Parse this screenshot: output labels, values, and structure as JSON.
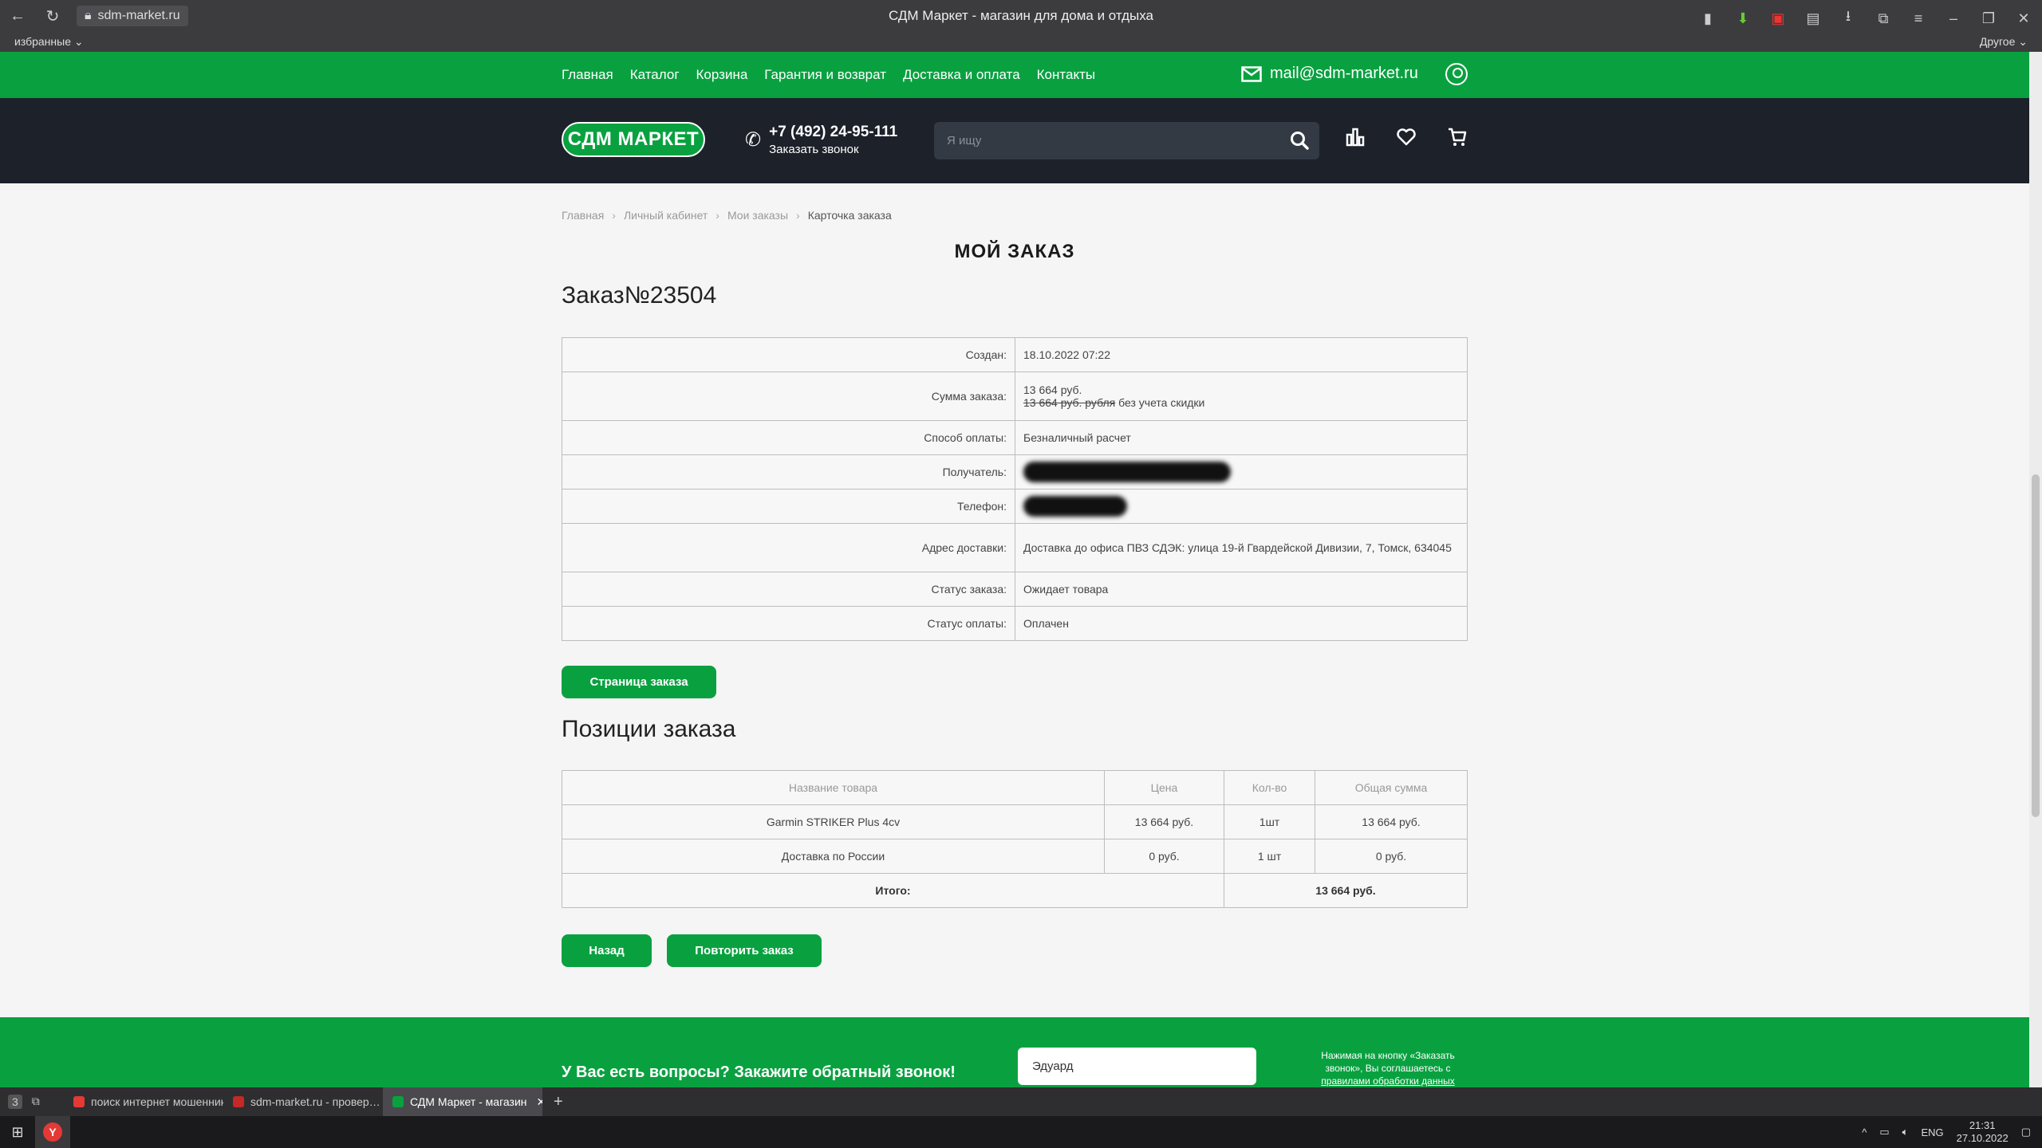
{
  "browser": {
    "url": "sdm-market.ru",
    "window_title": "СДМ Маркет - магазин для дома и отдыха",
    "bookmarks_label": "избранные",
    "bookmarks_other": "Другое"
  },
  "topnav": {
    "links": [
      "Главная",
      "Каталог",
      "Корзина",
      "Гарантия и возврат",
      "Доставка и оплата",
      "Контакты"
    ],
    "email": "mail@sdm-market.ru"
  },
  "header": {
    "logo": "СДМ МАРКЕТ",
    "phone": "+7 (492) 24-95-111",
    "callback": "Заказать звонок",
    "search_placeholder": "Я ищу"
  },
  "breadcrumb": [
    "Главная",
    "Личный кабинет",
    "Мои заказы",
    "Карточка заказа"
  ],
  "page_title": "МОЙ ЗАКАЗ",
  "order_title": "Заказ№23504",
  "order_info": {
    "created_label": "Создан:",
    "created_value": "18.10.2022 07:22",
    "sum_label": "Сумма заказа:",
    "sum_value": "13 664 руб.",
    "sum_old": "13 664 руб. рубля",
    "sum_old_suffix": "без учета скидки",
    "payment_label": "Способ оплаты:",
    "payment_value": "Безналичный расчет",
    "recipient_label": "Получатель:",
    "phone_label": "Телефон:",
    "address_label": "Адрес доставки:",
    "address_value": "Доставка до офиса ПВЗ СДЭК: улица 19-й Гвардейской Дивизии, 7, Томск, 634045",
    "status_label": "Статус заказа:",
    "status_value": "Ожидает товара",
    "pay_status_label": "Статус оплаты:",
    "pay_status_value": "Оплачен"
  },
  "order_page_button": "Страница заказа",
  "positions_title": "Позиции заказа",
  "items_table": {
    "headers": [
      "Название товара",
      "Цена",
      "Кол-во",
      "Общая сумма"
    ],
    "rows": [
      [
        "Garmin STRIKER Plus 4cv",
        "13 664 руб.",
        "1шт",
        "13 664 руб."
      ],
      [
        "Доставка по России",
        "0 руб.",
        "1 шт",
        "0 руб."
      ]
    ],
    "total_label": "Итого:",
    "total_value": "13 664 руб."
  },
  "back_button": "Назад",
  "repeat_button": "Повторить заказ",
  "footer": {
    "question": "У Вас есть вопросы? Закажите обратный звонок!",
    "name_value": "Эдуард",
    "note_text": "Нажимая на кнопку «Заказать звонок», Вы соглашаетесь с",
    "note_link": "правилами обработки данных"
  },
  "tabs": [
    {
      "label": "поиск интернет мошенник",
      "color": "#e53935"
    },
    {
      "label": "sdm-market.ru - провер…",
      "color": "#c62828"
    },
    {
      "label": "СДМ Маркет - магазин",
      "color": "#09a140"
    }
  ],
  "taskbar": {
    "lang": "ENG",
    "time": "21:31",
    "date": "27.10.2022",
    "tab_count": "3"
  }
}
